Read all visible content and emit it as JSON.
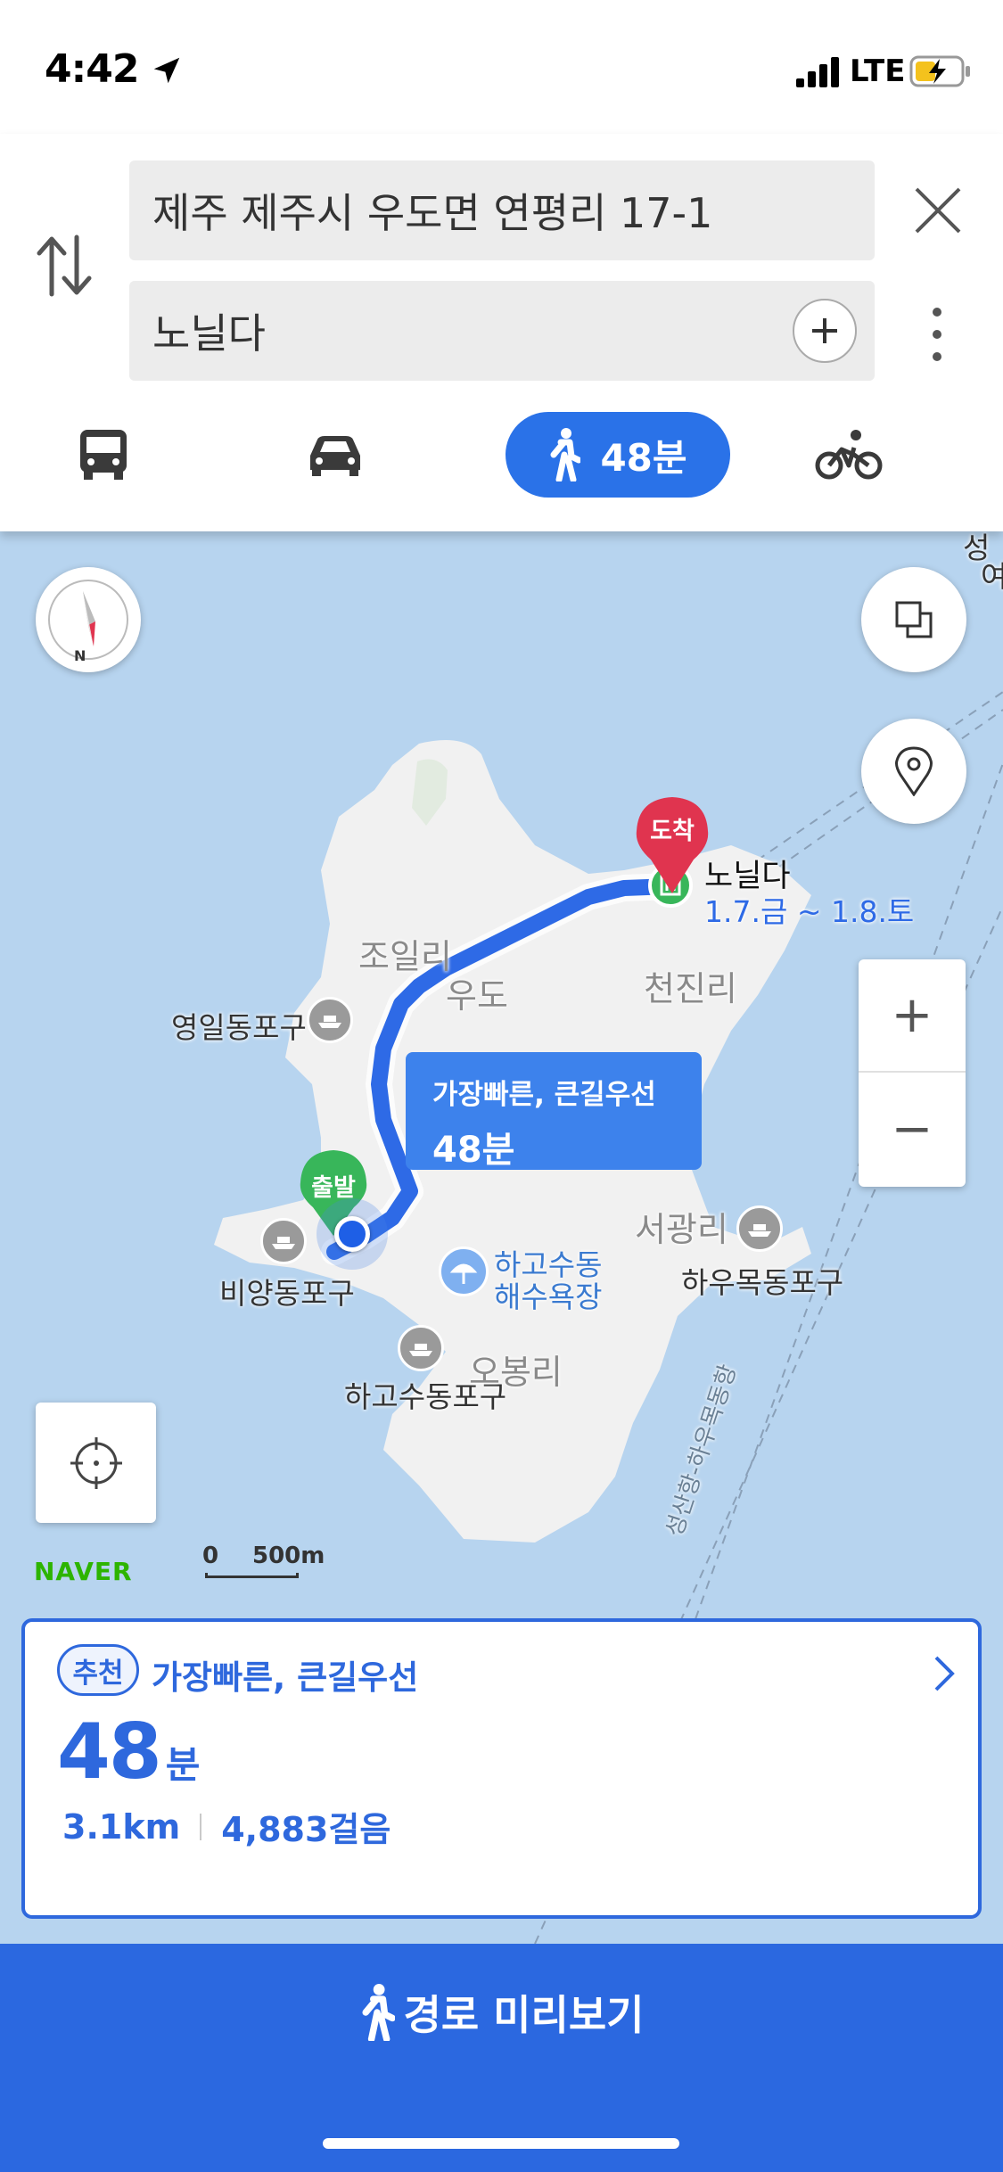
{
  "status_bar": {
    "time": "4:42",
    "network": "LTE"
  },
  "search": {
    "origin": "제주 제주시 우도면 연평리 17-1",
    "destination": "노닐다"
  },
  "modes": {
    "walk_time": "48분"
  },
  "map": {
    "places": {
      "joil": "조일리",
      "udo": "우도",
      "cheonjin": "천진리",
      "yeongil_port": "영일동포구",
      "seogwang": "서광리",
      "hawumok_port": "하우목동포구",
      "biyang_port": "비양동포구",
      "hagosu_beach_1": "하고수동",
      "hagosu_beach_2": "해수욕장",
      "hagosu_port": "하고수동포구",
      "obong": "오봉리",
      "ferry_route": "성산항-하우목동항",
      "top_edge_1": "성",
      "top_edge_2": "여"
    },
    "destination": {
      "pin_label": "도착",
      "name": "노닐다",
      "dates": "1.7.금 ~ 1.8.토"
    },
    "start_pin_label": "출발",
    "route_callout": {
      "title": "가장빠른, 큰길우선",
      "duration": "48분"
    },
    "zoom_in": "+",
    "zoom_out": "−",
    "brand": "NAVER",
    "scale": {
      "zero": "0",
      "distance": "500m"
    }
  },
  "route_card": {
    "tag": "추천",
    "name": "가장빠른, 큰길우선",
    "duration_value": "48",
    "duration_unit": "분",
    "distance": "3.1km",
    "steps": "4,883걸음"
  },
  "preview_button": {
    "label": "경로 미리보기"
  },
  "colors": {
    "accent": "#2e68dd",
    "route": "#3d82ec",
    "dest_pin": "#e0344f",
    "start_pin": "#38b65a",
    "water": "#b7d4ef"
  }
}
